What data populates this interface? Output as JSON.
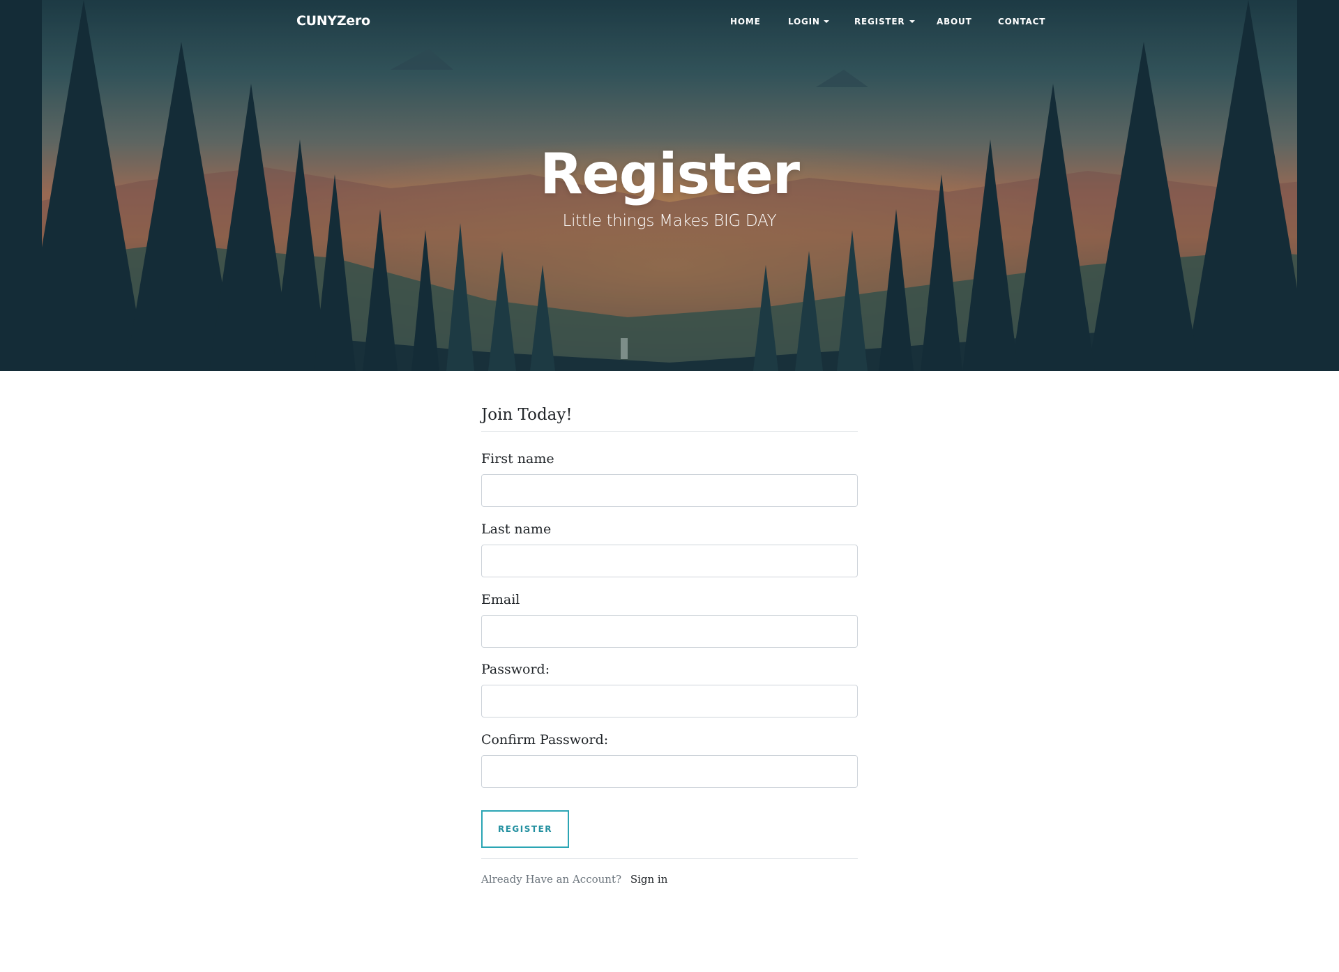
{
  "brand": "CUNYZero",
  "nav": {
    "home": "HOME",
    "login": "LOGIN",
    "register": "REGISTER",
    "about": "ABOUT",
    "contact": "CONTACT"
  },
  "hero": {
    "title": "Register",
    "subtitle": "Little things Makes BIG DAY"
  },
  "form": {
    "legend": "Join Today!",
    "fields": [
      {
        "label": "First name",
        "value": ""
      },
      {
        "label": "Last name",
        "value": ""
      },
      {
        "label": "Email",
        "value": ""
      },
      {
        "label": "Password:",
        "value": ""
      },
      {
        "label": "Confirm Password:",
        "value": ""
      }
    ],
    "submit_label": "REGISTER"
  },
  "footer": {
    "prompt": "Already Have an Account?",
    "link": "Sign in"
  },
  "colors": {
    "accent": "#2ba5b4",
    "text": "#212529",
    "muted": "#6c757d"
  }
}
